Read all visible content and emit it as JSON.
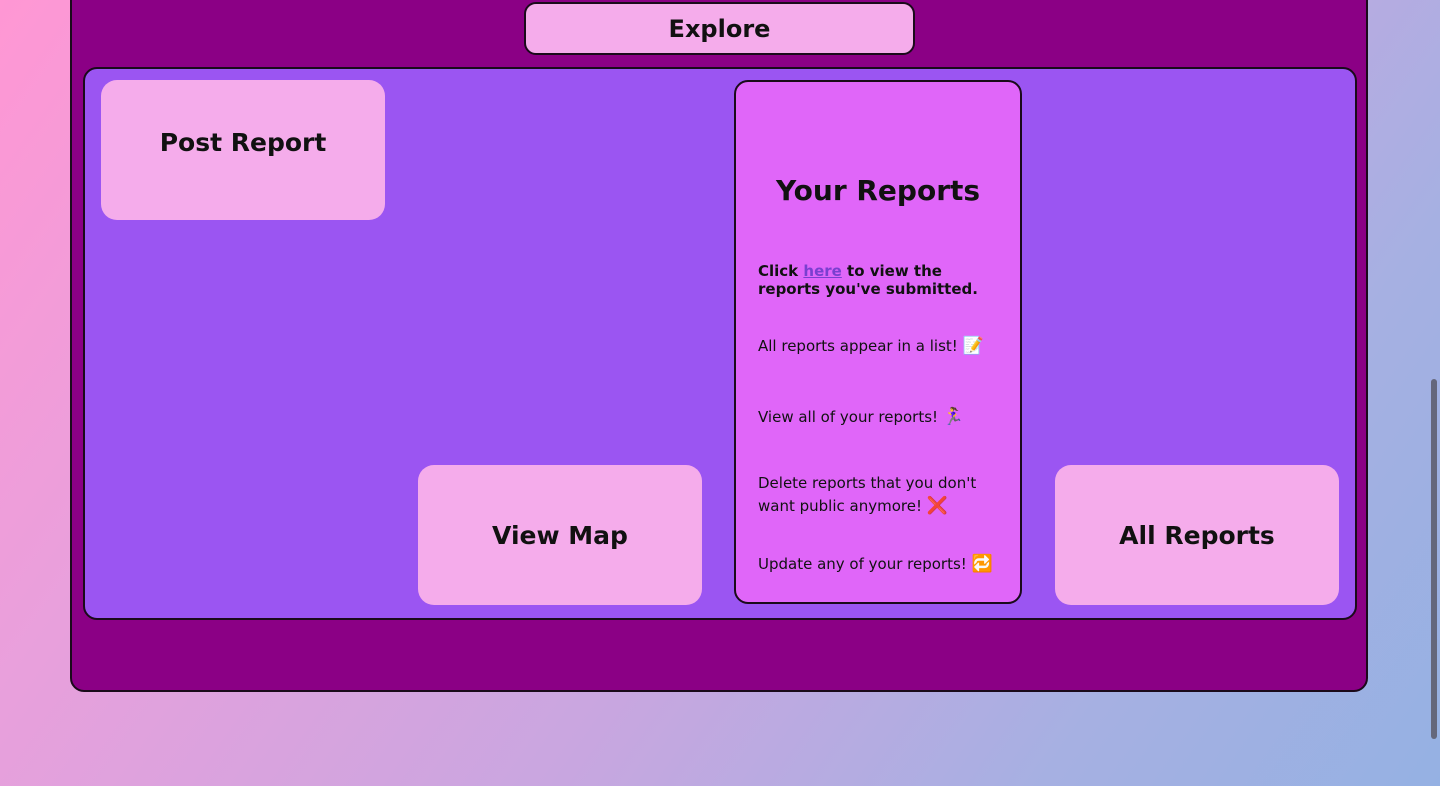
{
  "header": {
    "explore_label": "Explore"
  },
  "cards": {
    "post_report": "Post Report",
    "view_map": "View Map",
    "all_reports": "All Reports"
  },
  "your_reports": {
    "title": "Your Reports",
    "intro_prefix": "Click ",
    "intro_link": "here",
    "intro_suffix": " to view the reports you've submitted.",
    "features": [
      {
        "text": "All reports appear in a list! ",
        "emoji": "📝"
      },
      {
        "text": "View all of your reports! ",
        "emoji": "🏃‍♀️"
      },
      {
        "text": "Delete reports that you don't want public anymore! ",
        "emoji": "❌"
      },
      {
        "text": "Update any of your reports! ",
        "emoji": "🔁"
      }
    ]
  },
  "icons": [
    "memo-icon",
    "woman-running-icon",
    "cross-mark-icon",
    "repeat-icon"
  ]
}
